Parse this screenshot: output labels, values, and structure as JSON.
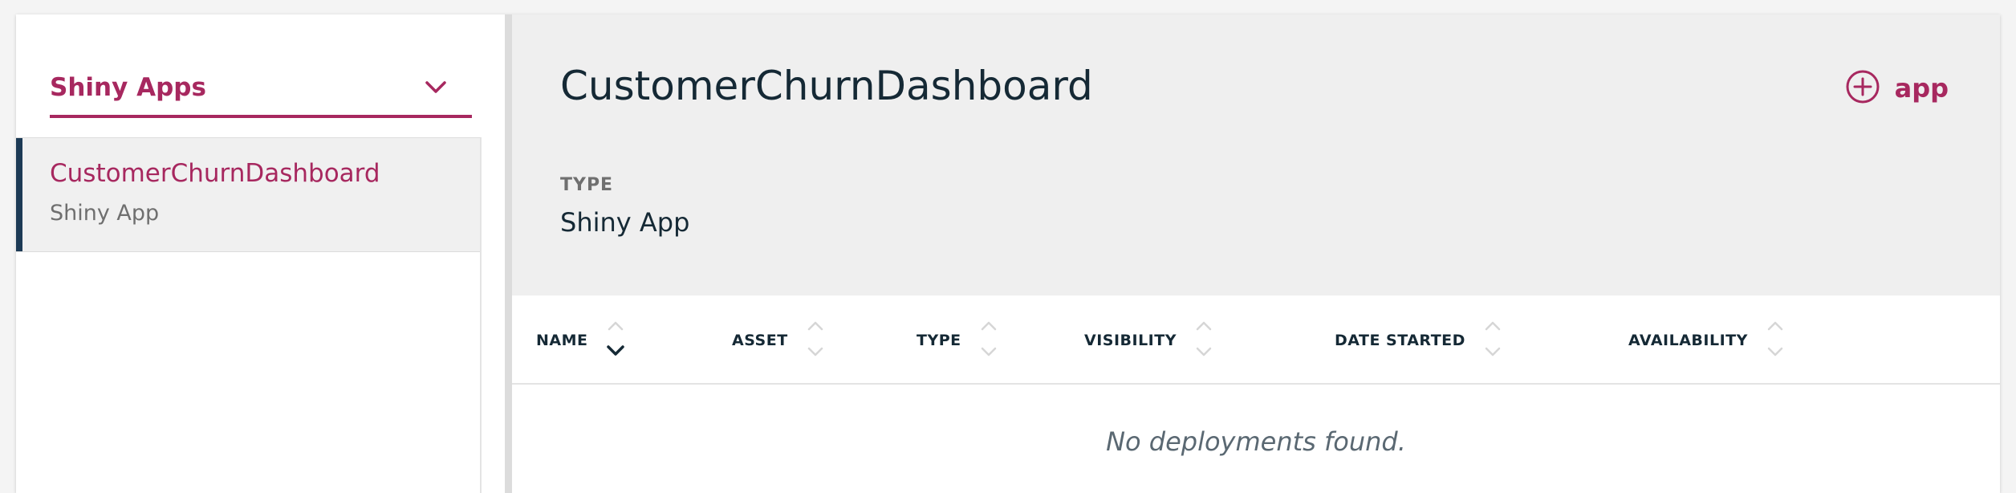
{
  "sidebar": {
    "filter_select": {
      "value": "Shiny Apps"
    },
    "items": [
      {
        "name": "CustomerChurnDashboard",
        "type": "Shiny App",
        "selected": true
      }
    ]
  },
  "detail": {
    "title": "CustomerChurnDashboard",
    "add_button_label": "app",
    "type_caption": "TYPE",
    "type_value": "Shiny App"
  },
  "deployments_table": {
    "columns": [
      {
        "label": "NAME",
        "sort": "descending"
      },
      {
        "label": "ASSET",
        "sort": "none"
      },
      {
        "label": "TYPE",
        "sort": "none"
      },
      {
        "label": "VISIBILITY",
        "sort": "none"
      },
      {
        "label": "DATE STARTED",
        "sort": "none"
      },
      {
        "label": "AVAILABILITY",
        "sort": "none"
      }
    ],
    "rows": [],
    "empty_message": "No deployments found."
  },
  "colors": {
    "accent": "#a7285f",
    "text": "#152935",
    "selected_bar": "#1c3a55"
  },
  "icons": {
    "dropdown": "chevron-down-icon",
    "add": "plus-circle-icon",
    "sort": "sort-arrows-icon"
  }
}
